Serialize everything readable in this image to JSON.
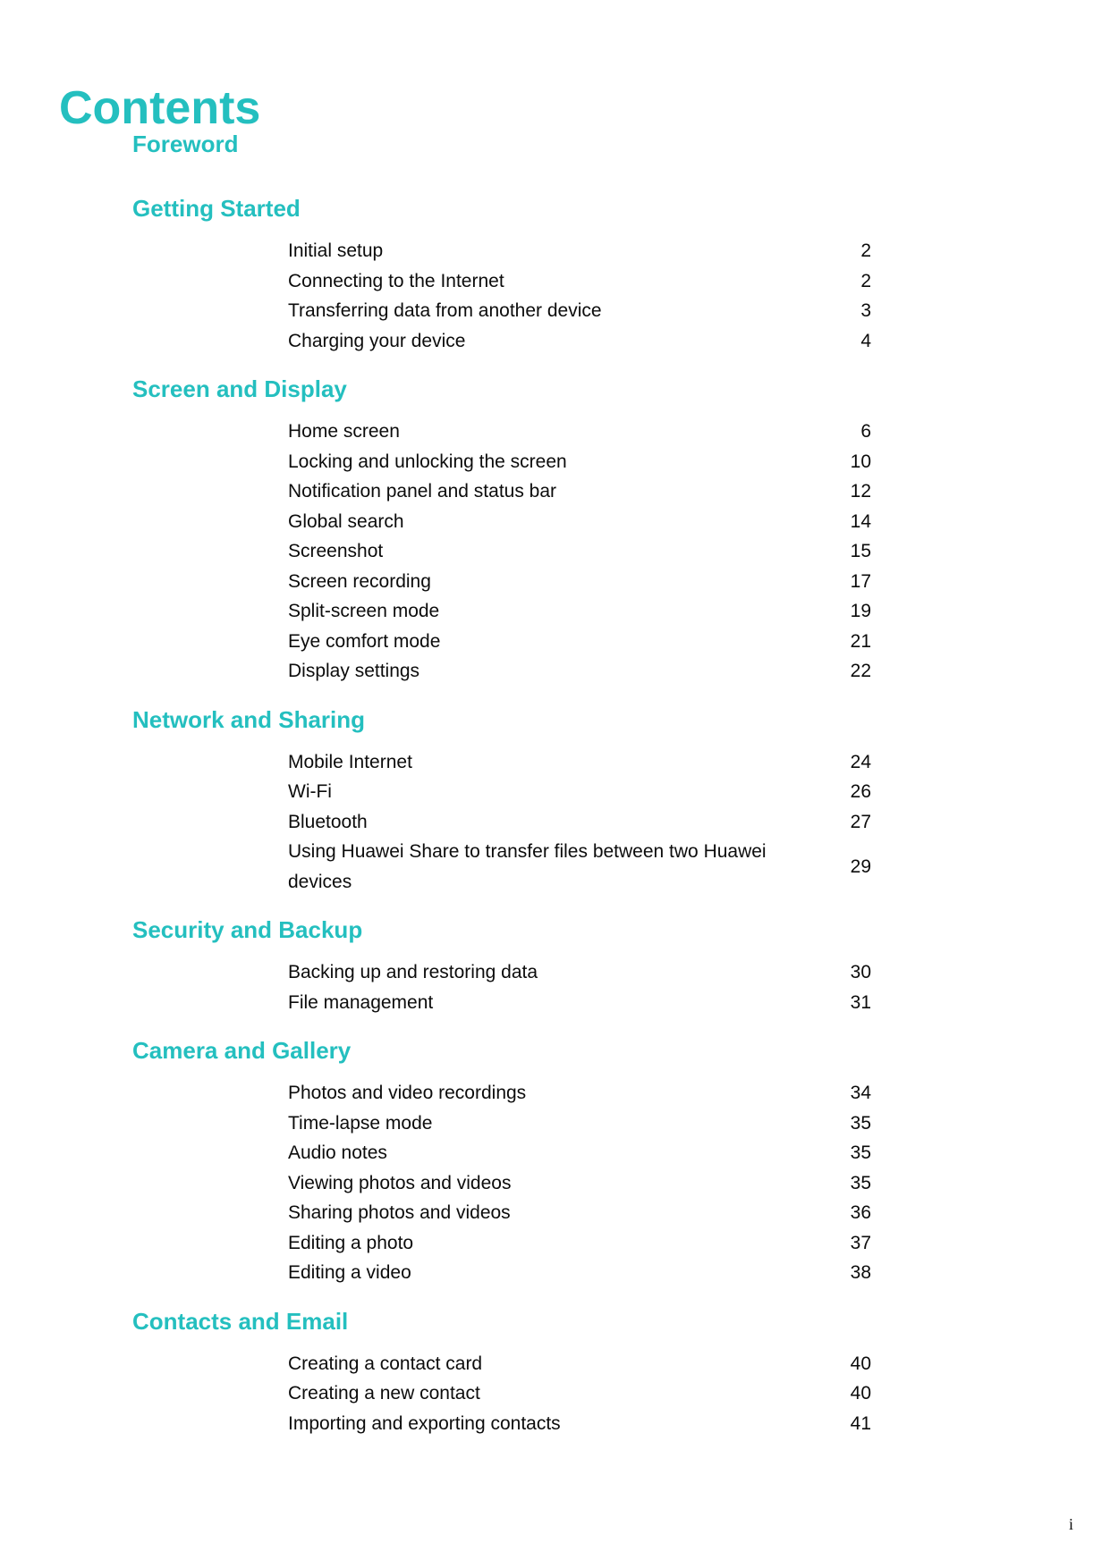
{
  "document": {
    "title": "Contents",
    "accent_color": "#24bfbf",
    "text_color": "#0c0c0c",
    "footer_page_label": "i"
  },
  "sections": [
    {
      "heading": "Foreword",
      "entries": []
    },
    {
      "heading": "Getting Started",
      "entries": [
        {
          "title": "Initial setup",
          "page": "2"
        },
        {
          "title": "Connecting to the Internet",
          "page": "2"
        },
        {
          "title": "Transferring data from another device",
          "page": "3"
        },
        {
          "title": "Charging your device",
          "page": "4"
        }
      ]
    },
    {
      "heading": "Screen and Display",
      "entries": [
        {
          "title": "Home screen",
          "page": "6"
        },
        {
          "title": "Locking and unlocking the screen",
          "page": "10"
        },
        {
          "title": "Notification panel and status bar",
          "page": "12"
        },
        {
          "title": "Global search",
          "page": "14"
        },
        {
          "title": "Screenshot",
          "page": "15"
        },
        {
          "title": "Screen recording",
          "page": "17"
        },
        {
          "title": "Split-screen mode",
          "page": "19"
        },
        {
          "title": "Eye comfort mode",
          "page": "21"
        },
        {
          "title": "Display settings",
          "page": "22"
        }
      ]
    },
    {
      "heading": "Network and Sharing",
      "entries": [
        {
          "title": "Mobile Internet",
          "page": "24"
        },
        {
          "title": "Wi-Fi",
          "page": "26"
        },
        {
          "title": "Bluetooth",
          "page": "27"
        },
        {
          "title": "Using Huawei Share to transfer files between two Huawei devices",
          "page": "29"
        }
      ]
    },
    {
      "heading": "Security and Backup",
      "entries": [
        {
          "title": "Backing up and restoring data",
          "page": "30"
        },
        {
          "title": "File management",
          "page": "31"
        }
      ]
    },
    {
      "heading": "Camera and Gallery",
      "entries": [
        {
          "title": "Photos and video recordings",
          "page": "34"
        },
        {
          "title": "Time-lapse mode",
          "page": "35"
        },
        {
          "title": "Audio notes",
          "page": "35"
        },
        {
          "title": "Viewing photos and videos",
          "page": "35"
        },
        {
          "title": "Sharing photos and videos",
          "page": "36"
        },
        {
          "title": "Editing a photo",
          "page": "37"
        },
        {
          "title": "Editing a video",
          "page": "38"
        }
      ]
    },
    {
      "heading": "Contacts and Email",
      "entries": [
        {
          "title": "Creating a contact card",
          "page": "40"
        },
        {
          "title": "Creating a new contact",
          "page": "40"
        },
        {
          "title": "Importing and exporting contacts",
          "page": "41"
        }
      ]
    }
  ]
}
